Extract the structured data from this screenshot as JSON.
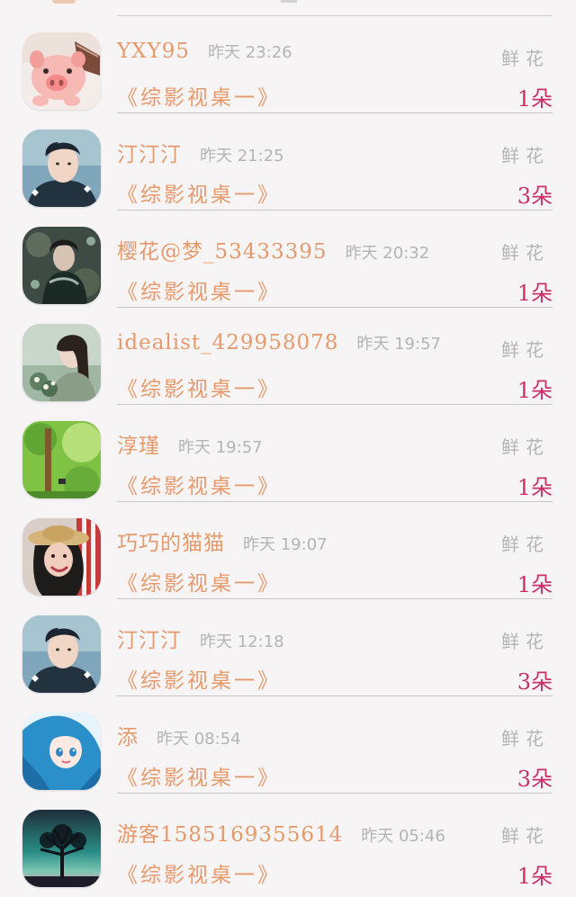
{
  "entries": [
    {
      "name": "YXY95",
      "time": "昨天 23:26",
      "work": "《综影视桌一》",
      "gift": "鲜花",
      "count": "1朵",
      "avatar": "pig-avatar"
    },
    {
      "name": "汀汀汀",
      "time": "昨天 21:25",
      "work": "《综影视桌一》",
      "gift": "鲜花",
      "count": "3朵",
      "avatar": "young-man-avatar"
    },
    {
      "name": "樱花@梦_53433395",
      "time": "昨天 20:32",
      "work": "《综影视桌一》",
      "gift": "鲜花",
      "count": "1朵",
      "avatar": "costume-avatar"
    },
    {
      "name": "idealist_429958078",
      "time": "昨天 19:57",
      "work": "《综影视桌一》",
      "gift": "鲜花",
      "count": "1朵",
      "avatar": "girl-flowers-avatar"
    },
    {
      "name": "淳瑾",
      "time": "昨天 19:57",
      "work": "《综影视桌一》",
      "gift": "鲜花",
      "count": "1朵",
      "avatar": "green-forest-avatar"
    },
    {
      "name": "巧巧的猫猫",
      "time": "昨天 19:07",
      "work": "《综影视桌一》",
      "gift": "鲜花",
      "count": "1朵",
      "avatar": "woman-hat-avatar"
    },
    {
      "name": "汀汀汀",
      "time": "昨天 12:18",
      "work": "《综影视桌一》",
      "gift": "鲜花",
      "count": "3朵",
      "avatar": "young-man-avatar"
    },
    {
      "name": "添",
      "time": "昨天 08:54",
      "work": "《综影视桌一》",
      "gift": "鲜花",
      "count": "3朵",
      "avatar": "anime-girl-avatar"
    },
    {
      "name": "游客1585169355614",
      "time": "昨天 05:46",
      "work": "《综影视桌一》",
      "gift": "鲜花",
      "count": "1朵",
      "avatar": "tree-sunset-avatar"
    }
  ]
}
